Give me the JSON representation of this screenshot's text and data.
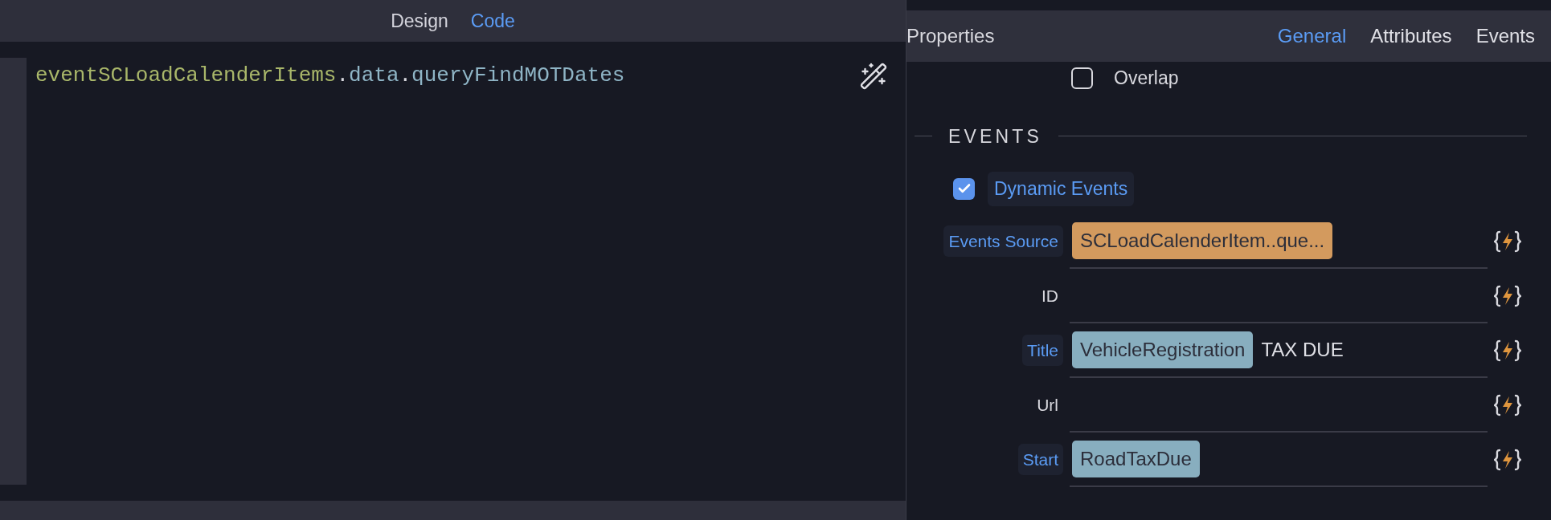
{
  "editor": {
    "tabs": [
      {
        "label": "Design",
        "selected": false
      },
      {
        "label": "Code",
        "selected": true
      }
    ],
    "code_tokens": [
      {
        "text": "eventSCLoadCalenderItems",
        "kind": "variable"
      },
      {
        "text": ".",
        "kind": "punct"
      },
      {
        "text": "data",
        "kind": "property"
      },
      {
        "text": ".",
        "kind": "punct"
      },
      {
        "text": "queryFindMOTDates",
        "kind": "property"
      }
    ]
  },
  "properties": {
    "title": "Properties",
    "tabs": [
      {
        "label": "General",
        "selected": true
      },
      {
        "label": "Attributes",
        "selected": false
      },
      {
        "label": "Events",
        "selected": false
      }
    ],
    "overlap": {
      "label": "Overlap",
      "checked": false
    },
    "section": "EVENTS",
    "dynamic_events": {
      "label": "Dynamic Events",
      "checked": true
    },
    "fields": [
      {
        "label": "Events Source",
        "bound": true,
        "chips": [
          {
            "text": "SCLoadCalenderItem..que...",
            "kind": "source"
          }
        ]
      },
      {
        "label": "ID",
        "bound": false
      },
      {
        "label": "Title",
        "bound": true,
        "chips": [
          {
            "text": "VehicleRegistration",
            "kind": "variable"
          }
        ],
        "value": "TAX DUE"
      },
      {
        "label": "Url",
        "bound": false
      },
      {
        "label": "Start",
        "bound": true,
        "chips": [
          {
            "text": "RoadTaxDue",
            "kind": "variable"
          }
        ]
      }
    ]
  }
}
